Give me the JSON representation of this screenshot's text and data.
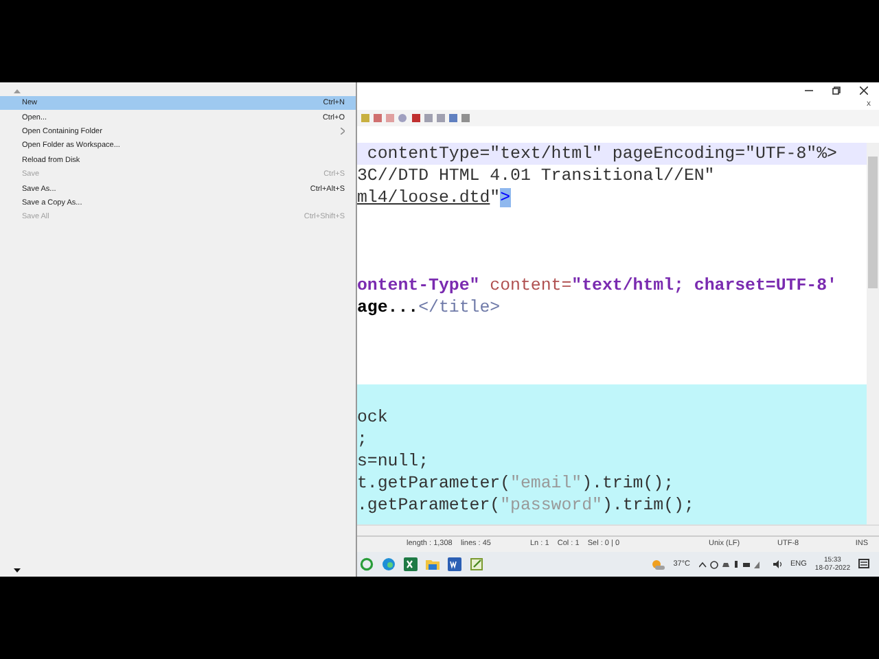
{
  "file_menu": {
    "items": [
      {
        "label": "New",
        "shortcut": "Ctrl+N",
        "selected": true,
        "disabled": false,
        "submenu": false
      },
      {
        "label": "Open...",
        "shortcut": "Ctrl+O",
        "selected": false,
        "disabled": false,
        "submenu": false
      },
      {
        "label": "Open Containing Folder",
        "selected": false,
        "disabled": false,
        "submenu": true
      },
      {
        "label": "Open Folder as Workspace...",
        "selected": false,
        "disabled": false,
        "submenu": false
      },
      {
        "label": "Reload from Disk",
        "selected": false,
        "disabled": false,
        "submenu": false
      },
      {
        "label": "Save",
        "shortcut": "Ctrl+S",
        "selected": false,
        "disabled": true,
        "submenu": false
      },
      {
        "label": "Save As...",
        "shortcut": "Ctrl+Alt+S",
        "selected": false,
        "disabled": false,
        "submenu": false
      },
      {
        "label": "Save a Copy As...",
        "selected": false,
        "disabled": false,
        "submenu": false
      },
      {
        "label": "Save All",
        "shortcut": "Ctrl+Shift+S",
        "selected": false,
        "disabled": true,
        "submenu": false
      }
    ]
  },
  "editor": {
    "close_tab": "x",
    "lines": [
      {
        "current": true,
        "highlighted": false,
        "segments": [
          {
            "text": " contentType=\"text/html\" pageEncoding=\"UTF-8\"%>",
            "kind": "plain"
          }
        ]
      },
      {
        "current": false,
        "highlighted": false,
        "segments": [
          {
            "text": "3C//DTD HTML 4.01 Transitional//EN\"",
            "kind": "plain"
          }
        ]
      },
      {
        "current": false,
        "highlighted": false,
        "segments": [
          {
            "text": "ml4/loose.dtd",
            "kind": "link"
          },
          {
            "text": "\"",
            "kind": "plain"
          },
          {
            "text": ">",
            "kind": "match"
          }
        ]
      },
      {
        "current": false,
        "highlighted": false
      },
      {
        "current": false,
        "highlighted": false
      },
      {
        "current": false,
        "highlighted": false
      },
      {
        "current": false,
        "highlighted": false,
        "segments": [
          {
            "text": "ontent-Type\"",
            "kind": "value"
          },
          {
            "text": " content=",
            "kind": "attr"
          },
          {
            "text": "\"text/html; charset=UTF-8'",
            "kind": "value"
          }
        ]
      },
      {
        "current": false,
        "highlighted": false,
        "segments": [
          {
            "text": "age...",
            "kind": "bold"
          },
          {
            "text": "</title>",
            "kind": "tag"
          }
        ]
      },
      {
        "current": false,
        "highlighted": false
      },
      {
        "current": false,
        "highlighted": false
      },
      {
        "current": false,
        "highlighted": false
      },
      {
        "current": false,
        "highlighted": true
      },
      {
        "current": false,
        "highlighted": true,
        "segments": [
          {
            "text": "ock",
            "kind": "plain"
          }
        ]
      },
      {
        "current": false,
        "highlighted": true,
        "segments": [
          {
            "text": ";",
            "kind": "plain"
          }
        ]
      },
      {
        "current": false,
        "highlighted": true,
        "segments": [
          {
            "text": "s=null;",
            "kind": "plain"
          }
        ]
      },
      {
        "current": false,
        "highlighted": true,
        "segments": [
          {
            "text": "t.getParameter(",
            "kind": "plain"
          },
          {
            "text": "\"email\"",
            "kind": "string"
          },
          {
            "text": ").trim();",
            "kind": "plain"
          }
        ]
      },
      {
        "current": false,
        "highlighted": true,
        "segments": [
          {
            "text": ".getParameter(",
            "kind": "plain"
          },
          {
            "text": "\"password\"",
            "kind": "string"
          },
          {
            "text": ").trim();",
            "kind": "plain"
          }
        ]
      }
    ]
  },
  "status_bar": [
    "length : 1,308    lines : 45",
    "Ln : 1    Col : 1    Sel : 0 | 0",
    "Unix (LF)",
    "UTF-8",
    "INS"
  ],
  "taskbar": {
    "temperature": "37°C",
    "language": "ENG",
    "time": "15:33",
    "date": "18-07-2022"
  }
}
